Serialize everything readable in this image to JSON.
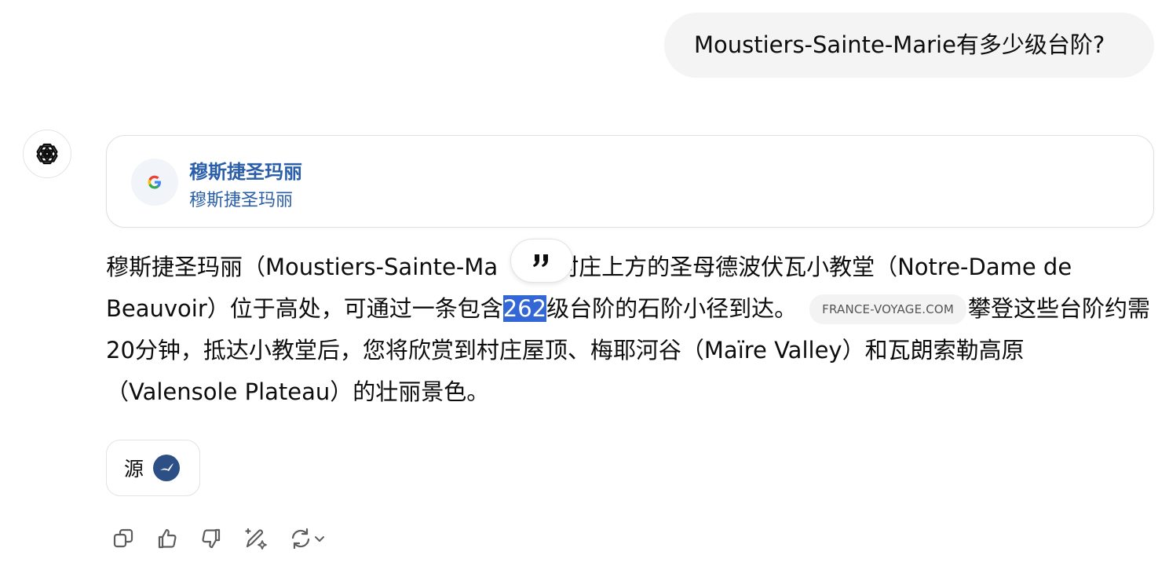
{
  "user_message": "Moustiers-Sainte-Marie有多少级台阶?",
  "assistant": {
    "avatar_icon": "openai-logo-icon",
    "search_card": {
      "icon": "google-g-icon",
      "title": "穆斯捷圣玛丽",
      "subtitle": "穆斯捷圣玛丽"
    },
    "answer": {
      "part1": "穆斯捷圣玛丽（Moustiers-Sainte-Ma",
      "part2": "村庄上方的圣母德波伏瓦小教堂（Notre-Dame de Beauvoir）位于高处，可通过一条包含",
      "highlight": "262",
      "part3": "级台阶的石阶小径到达。",
      "source_pill": "FRANCE-VOYAGE.COM",
      "part4": "攀登这些台阶约需20分钟，抵达小教堂后，您将欣赏到村庄屋顶、梅耶河谷（Maïre Valley）和瓦朗索勒高原（Valensole Plateau）的壮丽景色。",
      "highlight_color": "#3367d6"
    },
    "quote_button_icon": "quote-icon",
    "sources_button": {
      "label": "源",
      "icon": "source-favicon-icon"
    },
    "action_icons": [
      "copy-icon",
      "thumbs-up-icon",
      "thumbs-down-icon",
      "edit-sparkle-icon",
      "regenerate-icon",
      "chevron-down-icon"
    ]
  }
}
